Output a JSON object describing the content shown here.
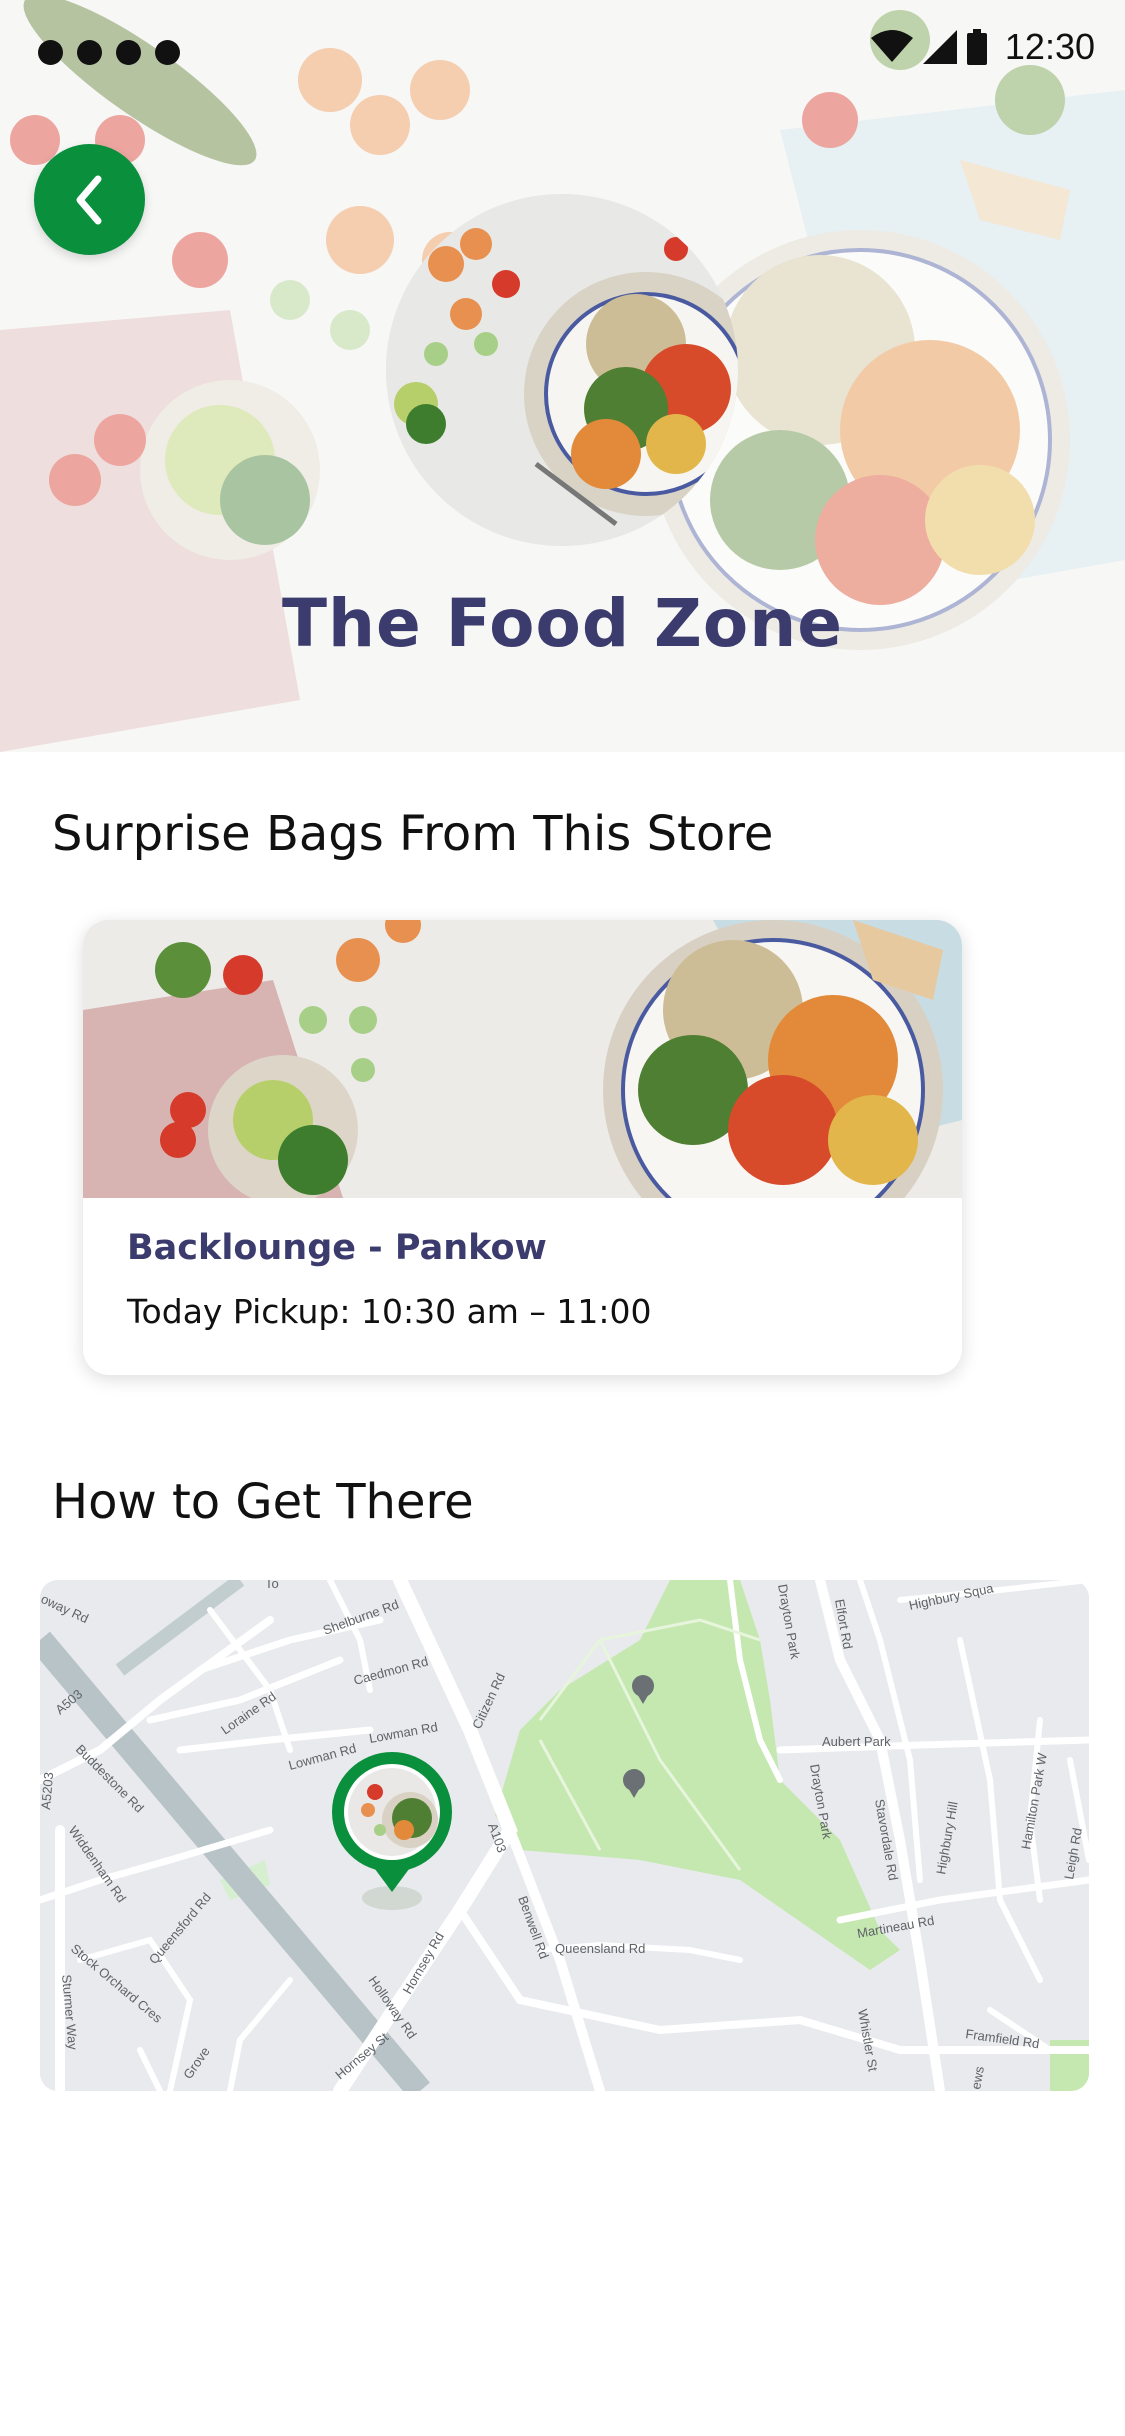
{
  "status_bar": {
    "time": "12:30",
    "icons": [
      "wifi-icon",
      "signal-icon",
      "battery-icon"
    ]
  },
  "hero": {
    "store_name": "The Food Zone",
    "back_icon": "chevron-left-icon"
  },
  "bags_section": {
    "title": "Surprise Bags From This Store",
    "cards": [
      {
        "name": "Backlounge - Pankow",
        "pickup": "Today Pickup: 10:30 am – 11:00"
      }
    ]
  },
  "directions_section": {
    "title": "How to Get There",
    "map_labels": {
      "holloway_rd_top": "oway Rd",
      "a503": "A503",
      "a5203": "A5203",
      "buddestone_rd": "Buddestone Rd",
      "widdenham_rd": "Widdenham Rd",
      "stock_orchard": "Stock Orchard Cres",
      "sturmer_way": "Sturmer Way",
      "queensford_rd": "Queensford Rd",
      "grove": "Grove",
      "shelburne_rd": "Shelburne Rd",
      "caedmon_rd": "Caedmon Rd",
      "loraine_rd": "Loraine Rd",
      "lowman_rd_1": "Lowman Rd",
      "lowman_rd_2": "Lowman Rd",
      "citizen_rd": "Citizen Rd",
      "a103": "A103",
      "hornsey_rd": "Hornsey Rd",
      "holloway_rd": "Holloway Rd",
      "hornsey_st": "Hornsey St",
      "benwell_rd": "Benwell Rd",
      "queensland_rd": "Queensland Rd",
      "drayton_park_1": "Drayton Park",
      "drayton_park_2": "Drayton Park",
      "elfort_rd": "Elfort Rd",
      "highbury_sq": "Highbury Squa",
      "aubert_park": "Aubert Park",
      "stavordale_rd": "Stavordale Rd",
      "highbury_hill": "Highbury Hill",
      "hamilton_park": "Hamilton Park W",
      "martineau_rd": "Martineau Rd",
      "whistler_st": "Whistler St",
      "framfield_rd": "Framfield Rd",
      "leigh_rd": "Leigh Rd",
      "ews": "ews",
      "to": "To"
    }
  },
  "colors": {
    "accent_green": "#0a8f3d",
    "title_navy": "#3b3b6d",
    "park_green": "#c5e8b0"
  }
}
